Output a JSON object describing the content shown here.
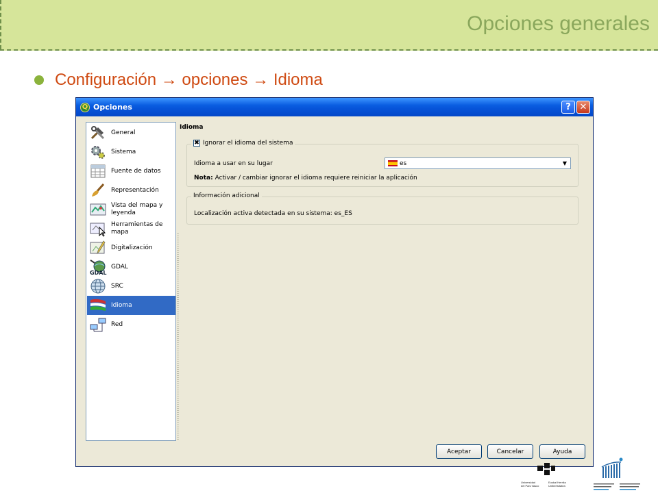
{
  "slide": {
    "title": "Opciones generales",
    "bullet": "Configuración → opciones → Idioma",
    "colors": {
      "header_bg": "#d6e59a",
      "title": "#8aa75c",
      "bullet_text": "#cf4a12",
      "bullet_dot": "#8bb33c"
    }
  },
  "dialog": {
    "title": "Opciones",
    "help_btn": "?",
    "close_btn": "✕",
    "sidebar": {
      "items": [
        {
          "label": "General",
          "icon": "tools-icon"
        },
        {
          "label": "Sistema",
          "icon": "gears-icon"
        },
        {
          "label": "Fuente de datos",
          "icon": "table-icon"
        },
        {
          "label": "Representación",
          "icon": "brush-icon"
        },
        {
          "label": "Vista del mapa y leyenda",
          "icon": "map-view-icon"
        },
        {
          "label": "Herramientas de mapa",
          "icon": "map-tools-icon"
        },
        {
          "label": "Digitalización",
          "icon": "digitize-icon"
        },
        {
          "label": "GDAL",
          "icon": "gdal-icon"
        },
        {
          "label": "SRC",
          "icon": "globe-icon"
        },
        {
          "label": "Idioma",
          "icon": "language-flags-icon",
          "selected": true
        },
        {
          "label": "Red",
          "icon": "network-icon"
        }
      ]
    },
    "panel": {
      "title": "Idioma",
      "group1": {
        "legend": "Ignorar el idioma del sistema",
        "checked": true,
        "checkmark": "✖",
        "lang_label": "Idioma a usar en su lugar",
        "lang_value": "es",
        "note_bold": "Nota:",
        "note_text": " Activar / cambiar ignorar el idioma requiere reiniciar la aplicación"
      },
      "group2": {
        "legend": "Información adicional",
        "text": "Localización activa detectada en su sistema: es_ES"
      }
    },
    "buttons": {
      "ok": "Aceptar",
      "cancel": "Cancelar",
      "help": "Ayuda"
    }
  },
  "logos": {
    "upv_line1": "Universidad",
    "upv_line2": "del País Vasco",
    "ehu_line1": "Euskal Herriko",
    "ehu_line2": "Unibertsitatea"
  }
}
